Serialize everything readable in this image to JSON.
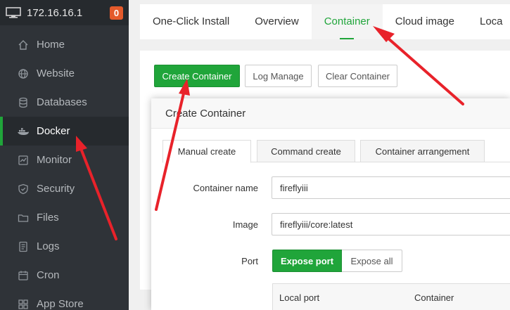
{
  "sidebar": {
    "ip": "172.16.16.1",
    "badge": "0",
    "items": [
      {
        "label": "Home",
        "icon": "home-icon"
      },
      {
        "label": "Website",
        "icon": "globe-icon"
      },
      {
        "label": "Databases",
        "icon": "database-icon"
      },
      {
        "label": "Docker",
        "icon": "docker-icon"
      },
      {
        "label": "Monitor",
        "icon": "monitor-icon"
      },
      {
        "label": "Security",
        "icon": "shield-icon"
      },
      {
        "label": "Files",
        "icon": "folder-icon"
      },
      {
        "label": "Logs",
        "icon": "logs-icon"
      },
      {
        "label": "Cron",
        "icon": "clock-icon"
      },
      {
        "label": "App Store",
        "icon": "apps-icon"
      }
    ]
  },
  "tabs": [
    "One-Click Install",
    "Overview",
    "Container",
    "Cloud image",
    "Loca"
  ],
  "toolbar": {
    "create": "Create Container",
    "log": "Log Manage",
    "clear": "Clear Container"
  },
  "modal": {
    "title": "Create Container",
    "tabs": [
      "Manual create",
      "Command create",
      "Container arrangement"
    ],
    "name_label": "Container name",
    "name_value": "fireflyiii",
    "image_label": "Image",
    "image_value": "fireflyiii/core:latest",
    "port_label": "Port",
    "expose_port": "Expose port",
    "expose_all": "Expose all",
    "col_local": "Local port",
    "col_container": "Container"
  },
  "colors": {
    "accent": "#20a53a",
    "sidebar": "#2f3338",
    "badge": "#e45a2b",
    "arrow": "#e8222a"
  }
}
